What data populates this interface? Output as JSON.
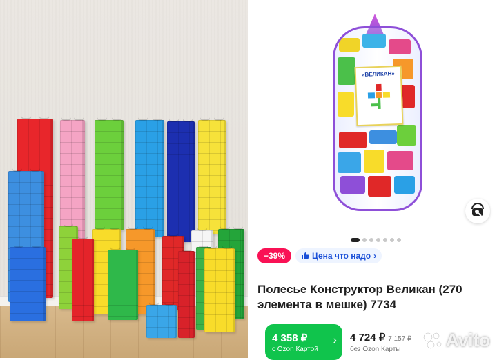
{
  "badges": {
    "discount": "−39%",
    "price_tag": "Цена что надо",
    "chevron": "›"
  },
  "product": {
    "title": "Полесье Конструктор Великан (270 элемента в мешке) 7734",
    "box_label": "«ВЕЛИКАН»"
  },
  "prices": {
    "ozon_card_price": "4 358 ₽",
    "ozon_card_label": "с Ozon Картой",
    "regular_price": "4 724 ₽",
    "old_price": "7 157 ₽",
    "regular_label": "без Ozon Карты"
  },
  "gallery": {
    "dots_total": 7,
    "active_index": 0
  },
  "watermark": {
    "text": "Avito"
  },
  "colors": {
    "discount": "#f91155",
    "ozon_green": "#10c44c",
    "bag_purple": "#8e4fd8",
    "price_tag_text": "#1a4fd8"
  },
  "icons": {
    "search": "image-search-icon",
    "thumbs_up": "thumbs-up-icon",
    "chevron": "chevron-right-icon"
  }
}
